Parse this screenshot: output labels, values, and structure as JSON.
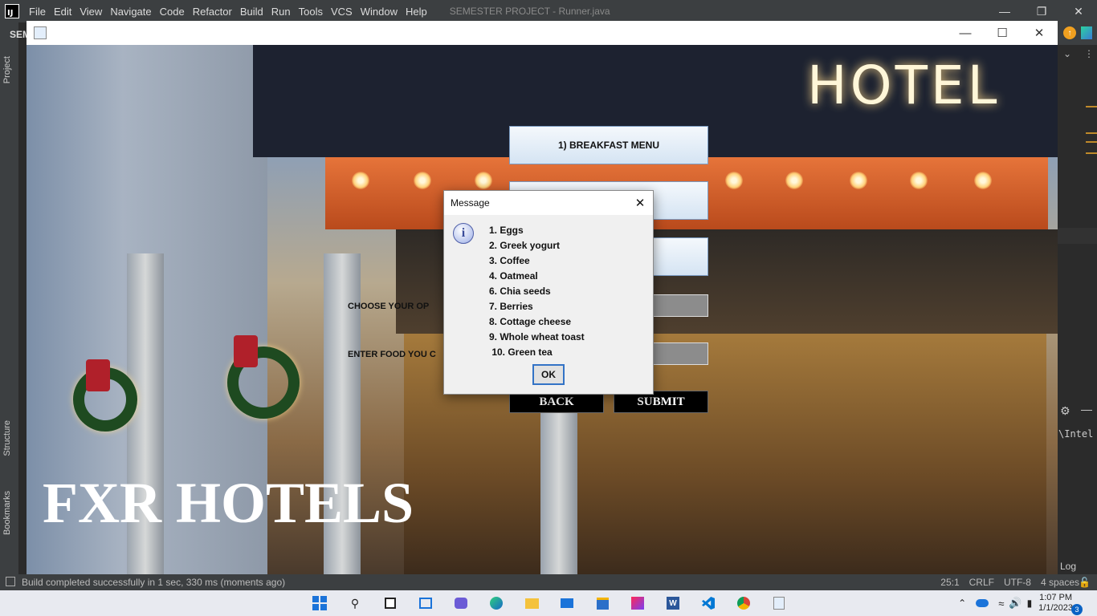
{
  "ide": {
    "menu": [
      "File",
      "Edit",
      "View",
      "Navigate",
      "Code",
      "Refactor",
      "Build",
      "Run",
      "Tools",
      "VCS",
      "Window",
      "Help"
    ],
    "title": "SEMESTER PROJECT - Runner.java",
    "project_abbrev": "SEM",
    "left_tabs": {
      "project": "Project",
      "structure": "Structure",
      "bookmarks": "Bookmarks"
    },
    "right_text": "\\Intel",
    "right_log": "Log",
    "status": {
      "message": "Build completed successfully in 1 sec, 330 ms (moments ago)",
      "position": "25:1",
      "line_ending": "CRLF",
      "encoding": "UTF-8",
      "indent": "4 spaces"
    }
  },
  "app": {
    "sign_text": "HOTEL",
    "brand": "FXR HOTELS",
    "breakfast_button": "1) BREAKFAST MENU",
    "choose_label": "CHOOSE YOUR OP",
    "enter_label": "ENTER FOOD YOU C",
    "back_button": "BACK",
    "submit_button": "SUBMIT"
  },
  "dialog": {
    "title": "Message",
    "items": [
      "1. Eggs",
      "2. Greek yogurt",
      "3. Coffee",
      "4. Oatmeal",
      "6. Chia seeds",
      "7. Berries",
      "8. Cottage cheese",
      "9. Whole wheat toast",
      " 10. Green tea"
    ],
    "ok": "OK"
  },
  "taskbar": {
    "time": "1:07 PM",
    "date": "1/1/2023",
    "notifications": "3"
  }
}
